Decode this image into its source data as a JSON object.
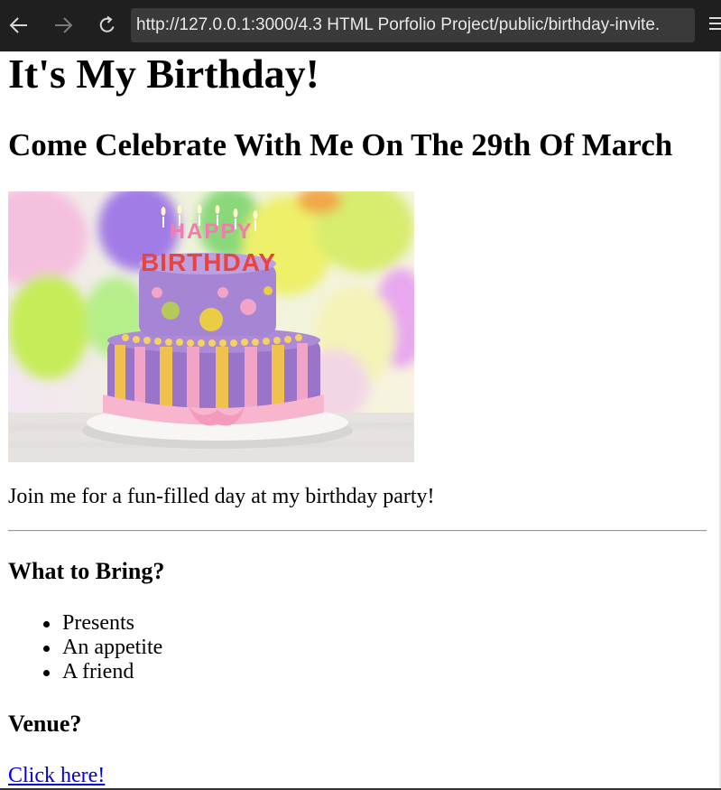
{
  "browser": {
    "url": "http://127.0.0.1:3000/4.3 HTML Porfolio Project/public/birthday-invite."
  },
  "page": {
    "heading": "It's My Birthday!",
    "subheading": "Come Celebrate With Me On The 29th Of March",
    "image_alt": "Happy Birthday cake",
    "cake_topper_line1": "HAPPY",
    "cake_topper_line2": "BIRTHDAY",
    "intro": "Join me for a fun-filled day at my birthday party!",
    "bring_heading": "What to Bring?",
    "bring_items": [
      "Presents",
      "An appetite",
      "A friend"
    ],
    "venue_heading": "Venue?",
    "venue_link": "Click here!"
  },
  "colors": {
    "chrome": "#1f1f1f",
    "url_bar": "#3a3a3a",
    "link": "#0000ee"
  }
}
